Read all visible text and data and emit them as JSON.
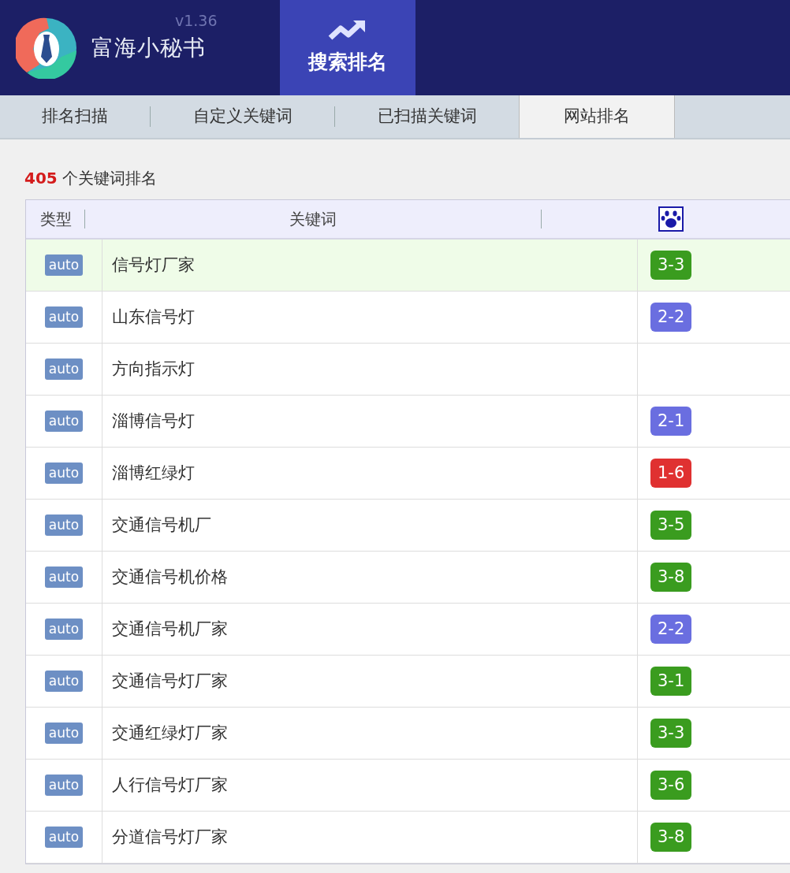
{
  "app": {
    "name": "富海小秘书",
    "version": "v1.36"
  },
  "nav": [
    {
      "label": "搜索排名",
      "selected": true
    }
  ],
  "tabs": [
    {
      "label": "排名扫描",
      "selected": false
    },
    {
      "label": "自定义关键词",
      "selected": false
    },
    {
      "label": "已扫描关键词",
      "selected": false
    },
    {
      "label": "网站排名",
      "selected": true
    }
  ],
  "summary": {
    "count": "405",
    "text": "个关键词排名"
  },
  "table": {
    "columns": [
      "类型",
      "关键词"
    ],
    "rows": [
      {
        "type": "auto",
        "keyword": "信号灯厂家",
        "rank": "3-3",
        "color": "#3a9c1f",
        "selected": true
      },
      {
        "type": "auto",
        "keyword": "山东信号灯",
        "rank": "2-2",
        "color": "#6a6ee0",
        "selected": false
      },
      {
        "type": "auto",
        "keyword": "方向指示灯",
        "selected": false
      },
      {
        "type": "auto",
        "keyword": "淄博信号灯",
        "rank": "2-1",
        "color": "#6a6ee0",
        "selected": false
      },
      {
        "type": "auto",
        "keyword": "淄博红绿灯",
        "rank": "1-6",
        "color": "#e03131",
        "selected": false
      },
      {
        "type": "auto",
        "keyword": "交通信号机厂",
        "rank": "3-5",
        "color": "#3a9c1f",
        "selected": false
      },
      {
        "type": "auto",
        "keyword": "交通信号机价格",
        "rank": "3-8",
        "color": "#3a9c1f",
        "selected": false
      },
      {
        "type": "auto",
        "keyword": "交通信号机厂家",
        "rank": "2-2",
        "color": "#6a6ee0",
        "selected": false
      },
      {
        "type": "auto",
        "keyword": "交通信号灯厂家",
        "rank": "3-1",
        "color": "#3a9c1f",
        "selected": false
      },
      {
        "type": "auto",
        "keyword": "交通红绿灯厂家",
        "rank": "3-3",
        "color": "#3a9c1f",
        "selected": false
      },
      {
        "type": "auto",
        "keyword": "人行信号灯厂家",
        "rank": "3-6",
        "color": "#3a9c1f",
        "selected": false
      },
      {
        "type": "auto",
        "keyword": "分道信号灯厂家",
        "rank": "3-8",
        "color": "#3a9c1f",
        "selected": false
      }
    ]
  }
}
